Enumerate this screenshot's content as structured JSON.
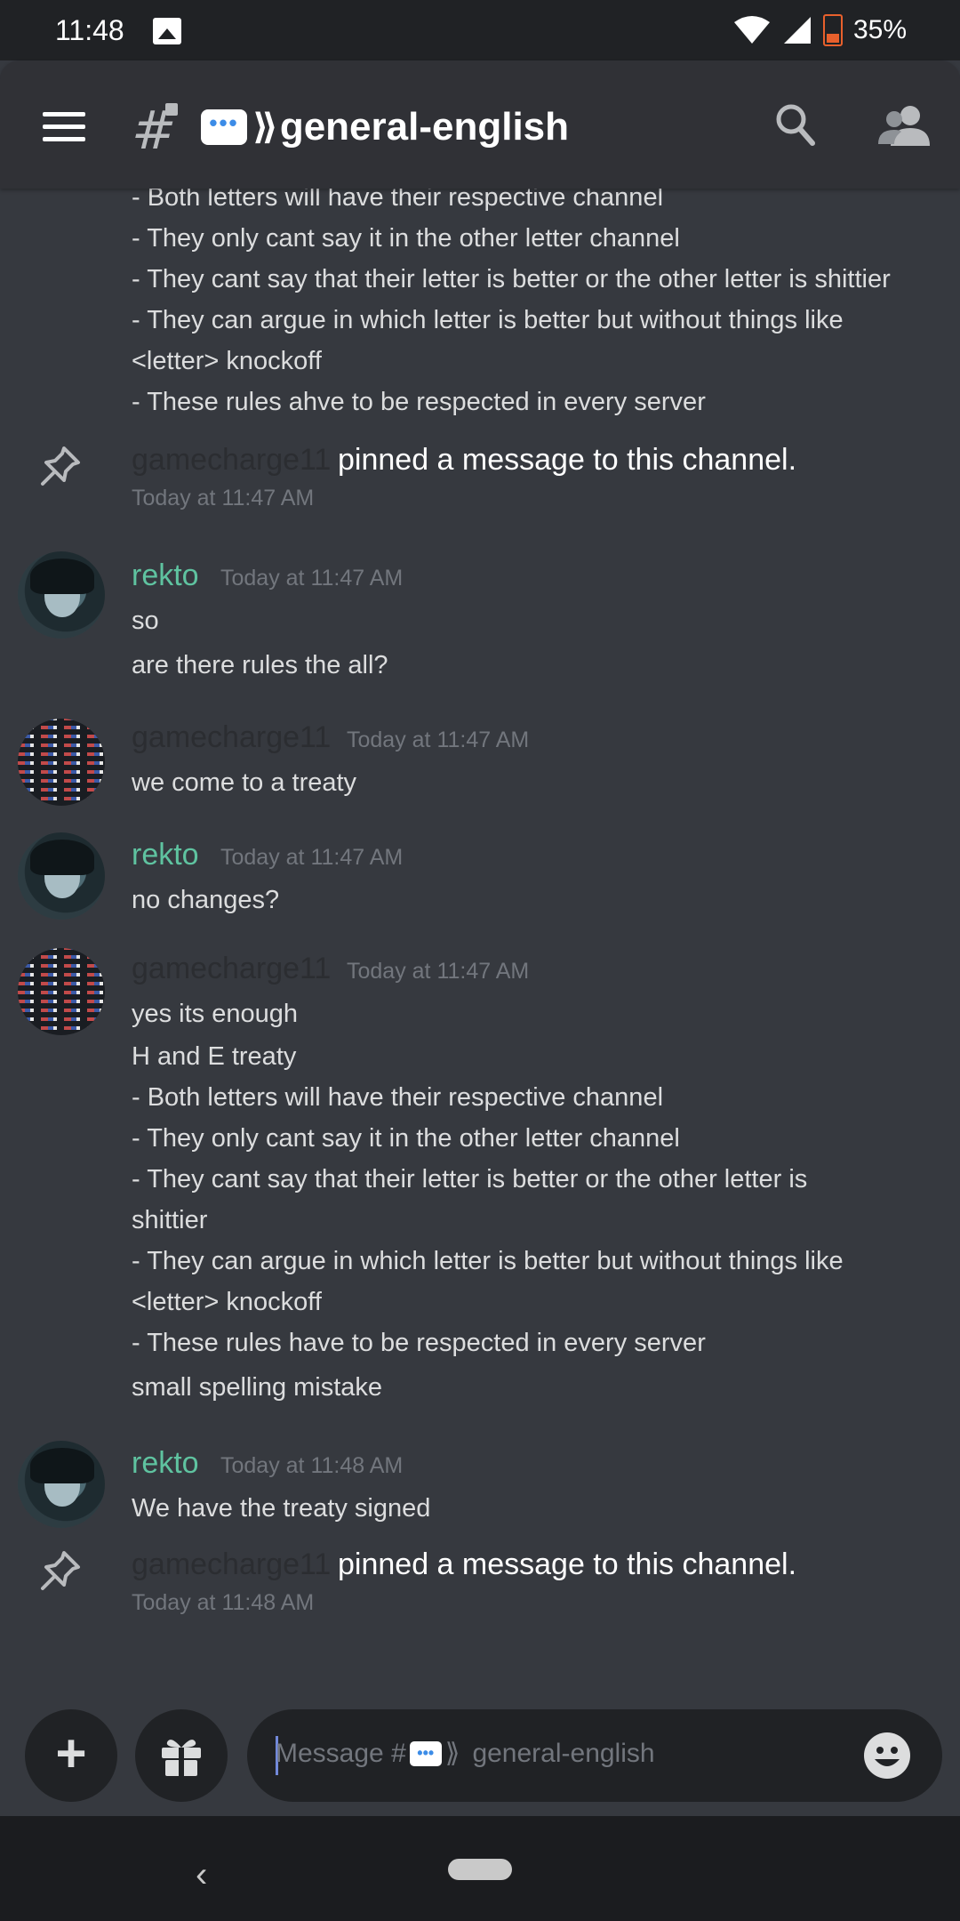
{
  "status_bar": {
    "time": "11:48",
    "battery": "35%"
  },
  "header": {
    "channel_name": "general-english"
  },
  "top_fragment": {
    "lines": [
      "- Both letters will have their respective channel",
      "- They only cant say it in the other letter channel",
      "- They cant say that their letter is better or the other letter is shittier",
      "- They can argue in which letter is better but without things like",
      "<letter> knockoff",
      "- These rules ahve to be respected in every server"
    ]
  },
  "messages": [
    {
      "type": "pin",
      "author": "gamecharge11",
      "text": "pinned a message to this channel.",
      "time": "Today at 11:47 AM"
    },
    {
      "type": "msg",
      "author": "rekto",
      "time": "Today at 11:47 AM",
      "lines": [
        "so",
        "are there rules the all?"
      ]
    },
    {
      "type": "msg",
      "author": "gamecharge11",
      "time": "Today at 11:47 AM",
      "lines": [
        "we come to a treaty"
      ]
    },
    {
      "type": "msg",
      "author": "rekto",
      "time": "Today at 11:47 AM",
      "lines": [
        "no changes?"
      ]
    },
    {
      "type": "msg",
      "author": "gamecharge11",
      "time": "Today at 11:47 AM",
      "lines": [
        "yes its enough",
        "H and E treaty",
        "- Both letters will have their respective channel",
        "- They only cant say it in the other letter channel",
        "- They cant say that their letter is better or the other letter is",
        "shittier",
        "- They can argue in which letter is better but without things like",
        "<letter> knockoff",
        "- These rules have to be respected in every server",
        "small spelling mistake"
      ]
    },
    {
      "type": "msg",
      "author": "rekto",
      "time": "Today at 11:48 AM",
      "lines": [
        "We have the treaty signed"
      ]
    },
    {
      "type": "pin",
      "author": "gamecharge11",
      "text": "pinned a message to this channel.",
      "time": "Today at 11:48 AM"
    }
  ],
  "composer": {
    "placeholder_prefix": "Message #",
    "placeholder_channel": "general-english"
  },
  "icons": {
    "menu": "hamburger-menu-icon",
    "channel": "locked-hash-icon",
    "search": "search-icon",
    "members": "members-icon",
    "pin": "pin-icon",
    "add": "plus-icon",
    "gift": "gift-icon",
    "emoji": "emoji-icon"
  },
  "colors": {
    "background": "#36393f",
    "header": "#303136",
    "username_rekto": "#5fc3a0",
    "username_gamecharge11": "#2b2d31",
    "timestamp": "#72767d",
    "text": "#dcddde"
  }
}
